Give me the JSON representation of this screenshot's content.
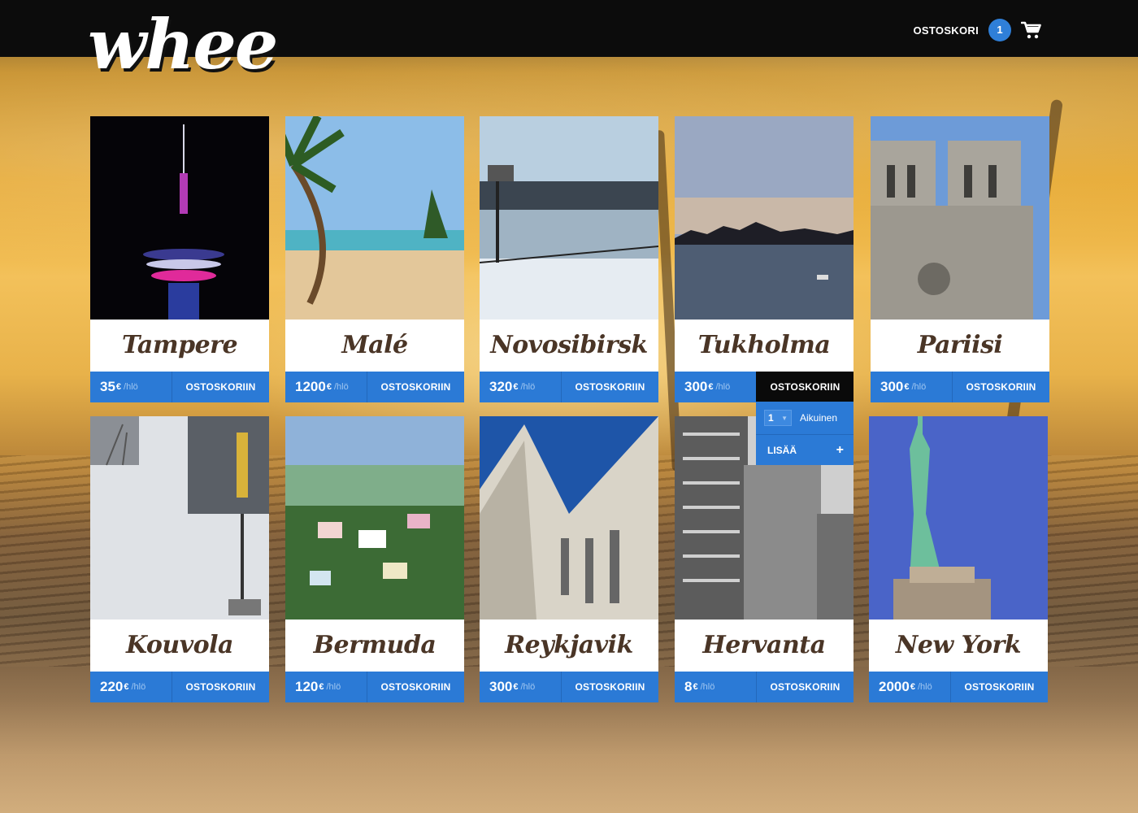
{
  "header": {
    "logo_text": "whee",
    "cart_label": "OSTOSKORI",
    "cart_count": "1"
  },
  "destinations": [
    {
      "name": "Tampere",
      "price": "35",
      "currency": "€",
      "unit": "/hlö",
      "button": "OSTOSKORIIN"
    },
    {
      "name": "Malé",
      "price": "1200",
      "currency": "€",
      "unit": "/hlö",
      "button": "OSTOSKORIIN"
    },
    {
      "name": "Novosibirsk",
      "price": "320",
      "currency": "€",
      "unit": "/hlö",
      "button": "OSTOSKORIIN"
    },
    {
      "name": "Tukholma",
      "price": "300",
      "currency": "€",
      "unit": "/hlö",
      "button": "OSTOSKORIIN"
    },
    {
      "name": "Pariisi",
      "price": "300",
      "currency": "€",
      "unit": "/hlö",
      "button": "OSTOSKORIIN"
    },
    {
      "name": "Kouvola",
      "price": "220",
      "currency": "€",
      "unit": "/hlö",
      "button": "OSTOSKORIIN"
    },
    {
      "name": "Bermuda",
      "price": "120",
      "currency": "€",
      "unit": "/hlö",
      "button": "OSTOSKORIIN"
    },
    {
      "name": "Reykjavik",
      "price": "300",
      "currency": "€",
      "unit": "/hlö",
      "button": "OSTOSKORIIN"
    },
    {
      "name": "Hervanta",
      "price": "8",
      "currency": "€",
      "unit": "/hlö",
      "button": "OSTOSKORIIN"
    },
    {
      "name": "New York",
      "price": "2000",
      "currency": "€",
      "unit": "/hlö",
      "button": "OSTOSKORIIN"
    }
  ],
  "dropdown": {
    "quantity": "1",
    "quantity_label": "Aikuinen",
    "add_label": "LISÄÄ",
    "add_icon": "+"
  },
  "colors": {
    "accent": "#2b7ad6",
    "active_button": "#0a0a0a",
    "title_text": "#4a3526",
    "topbar": "#0c0c0c"
  },
  "icons": {
    "cart": "shopping-cart-icon",
    "quantity_caret": "chevron-down-icon",
    "add": "plus-icon"
  }
}
